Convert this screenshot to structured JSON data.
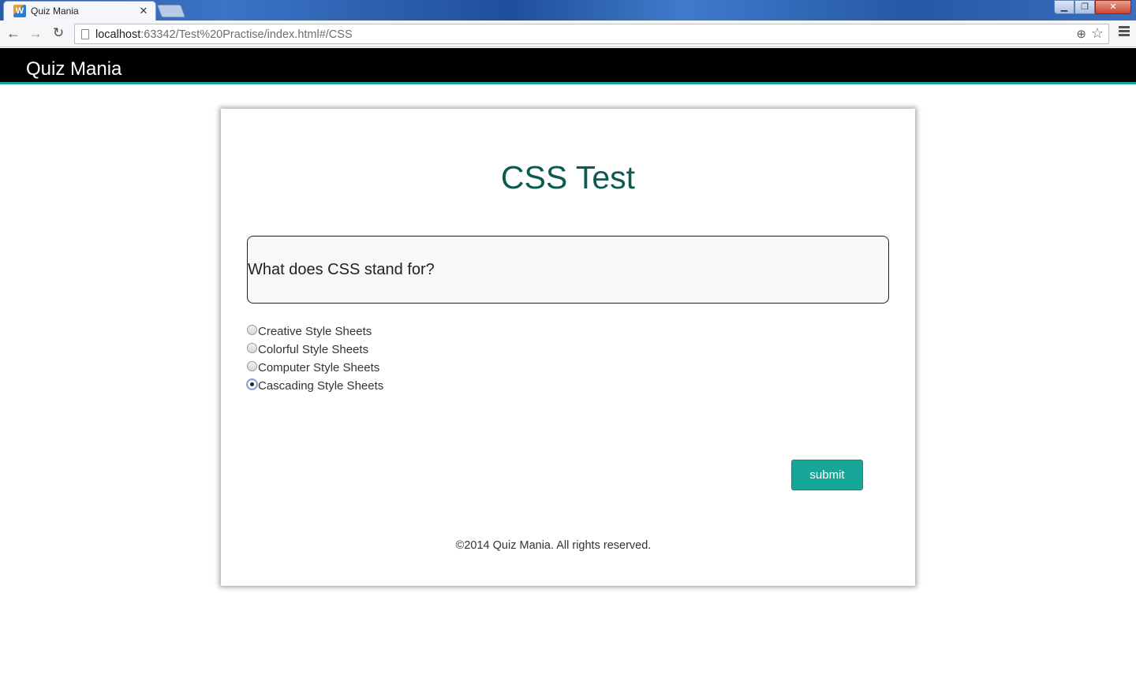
{
  "browser": {
    "tab_title": "Quiz Mania",
    "tab_favicon_glyph": "W",
    "url_host": "localhost",
    "url_rest": ":63342/Test%20Practise/index.html#/CSS",
    "icons": {
      "back": "back-arrow-icon",
      "forward": "forward-arrow-icon",
      "reload": "reload-icon",
      "zoom": "zoom-icon",
      "star": "bookmark-star-icon",
      "menu": "menu-icon"
    }
  },
  "header": {
    "brand": "Quiz Mania",
    "accent_color": "#16a596"
  },
  "quiz": {
    "title": "CSS Test",
    "title_color": "#0c5a50",
    "question": "What does CSS stand for?",
    "options": [
      {
        "label": "Creative Style Sheets",
        "selected": false
      },
      {
        "label": "Colorful Style Sheets",
        "selected": false
      },
      {
        "label": "Computer Style Sheets",
        "selected": false
      },
      {
        "label": "Cascading Style Sheets",
        "selected": true
      }
    ],
    "submit_label": "submit",
    "button_color": "#17a697"
  },
  "footer": {
    "text": "©2014 Quiz Mania. All rights reserved."
  }
}
